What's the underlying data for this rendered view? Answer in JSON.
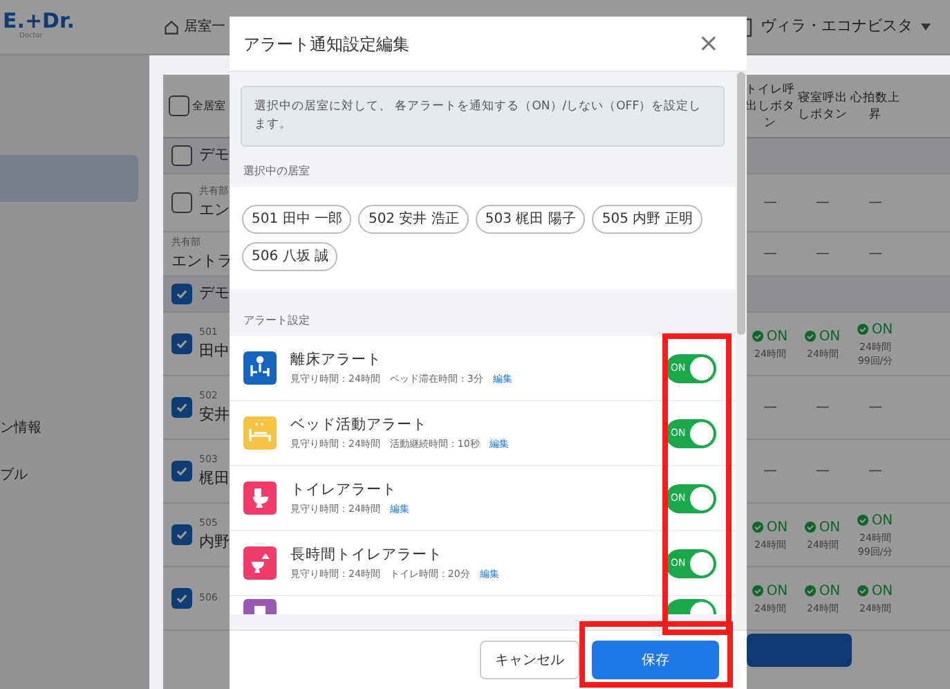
{
  "app": {
    "logo": "E.+Dr.",
    "logo_sub": "Doctor",
    "nav_label": "居室一",
    "facility": "ヴィラ・エコナビスタ"
  },
  "sidebar": {
    "items": [
      {
        "selected": true
      },
      {
        "label": "ン情報",
        "selected": false
      },
      {
        "label": "ブル",
        "selected": false
      }
    ]
  },
  "table": {
    "select_all": {
      "label": "全居室",
      "checked": false
    },
    "columns": [
      "トイレ呼出しボタン",
      "寝室呼出しボタン",
      "心拍数上昇"
    ],
    "rows": [
      {
        "kind": "group",
        "label": "デモ",
        "checked": false
      },
      {
        "kind": "room",
        "sub": "共有部",
        "label": "エン",
        "checked": false,
        "cells": [
          {
            "kind": "none",
            "text": "—"
          },
          {
            "kind": "none",
            "text": "—"
          },
          {
            "kind": "none",
            "text": "—"
          }
        ]
      },
      {
        "kind": "room",
        "sub": "共有部",
        "label": "エントラ",
        "cells": [
          {
            "kind": "none",
            "text": "—"
          },
          {
            "kind": "none",
            "text": "—"
          },
          {
            "kind": "none",
            "text": "—"
          }
        ]
      },
      {
        "kind": "group",
        "label": "デモ",
        "checked": true
      },
      {
        "kind": "room",
        "sub": "501",
        "label": "田中",
        "checked": true,
        "cells": [
          {
            "kind": "on",
            "text": "ON",
            "hours": "24時間"
          },
          {
            "kind": "on",
            "text": "ON",
            "hours": "24時間"
          },
          {
            "kind": "on",
            "text": "ON",
            "hours": "24時間",
            "extra": "99回/分"
          }
        ]
      },
      {
        "kind": "room",
        "sub": "502",
        "label": "安井",
        "checked": true,
        "cells": [
          {
            "kind": "none",
            "text": "—"
          },
          {
            "kind": "none",
            "text": "—"
          },
          {
            "kind": "none",
            "text": "—"
          }
        ]
      },
      {
        "kind": "room",
        "sub": "503",
        "label": "梶田",
        "checked": true,
        "cells": [
          {
            "kind": "none",
            "text": "—"
          },
          {
            "kind": "none",
            "text": "—"
          },
          {
            "kind": "none",
            "text": "—"
          }
        ]
      },
      {
        "kind": "room",
        "sub": "505",
        "label": "内野",
        "checked": true,
        "cells": [
          {
            "kind": "on",
            "text": "ON",
            "hours": "24時間"
          },
          {
            "kind": "on",
            "text": "ON",
            "hours": "24時間"
          },
          {
            "kind": "on",
            "text": "ON",
            "hours": "24時間",
            "extra": "99回/分"
          }
        ]
      },
      {
        "kind": "room",
        "sub": "506",
        "checked": true,
        "cells": [
          {
            "kind": "on",
            "text": "ON",
            "hours": "24時間"
          },
          {
            "kind": "on",
            "text": "ON",
            "hours": "24時間"
          },
          {
            "kind": "on",
            "text": "ON",
            "hours": "24時間"
          }
        ]
      }
    ]
  },
  "dialog": {
    "title": "アラート通知設定編集",
    "close": "×",
    "info": "選択中の居室に対して、 各アラートを通知する（ON）/しない（OFF）を設定します。",
    "rooms_label": "選択中の居室",
    "rooms": [
      "501 田中 一郎",
      "502 安井 浩正",
      "503 梶田 陽子",
      "505 内野 正明",
      "506 八坂 誠"
    ],
    "alerts_label": "アラート設定",
    "alerts": [
      {
        "kind": "bed-exit",
        "color": "#1565c0",
        "title": "離床アラート",
        "details": [
          "見守り時間：24時間",
          "ベッド滞在時間：3分"
        ],
        "edit": "編集",
        "on": true,
        "switch_label": "ON"
      },
      {
        "kind": "bed-activity",
        "color": "#f5c342",
        "title": "ベッド活動アラート",
        "details": [
          "見守り時間：24時間",
          "活動継続時間：10秒"
        ],
        "edit": "編集",
        "on": true,
        "switch_label": "ON"
      },
      {
        "kind": "toilet",
        "color": "#f23c6a",
        "title": "トイレアラート",
        "details": [
          "見守り時間：24時間"
        ],
        "edit": "編集",
        "on": true,
        "switch_label": "ON"
      },
      {
        "kind": "long-toilet",
        "color": "#f23c6a",
        "title": "長時間トイレアラート",
        "details": [
          "見守り時間：24時間",
          "トイレ時間：20分"
        ],
        "edit": "編集",
        "on": true,
        "switch_label": "ON"
      },
      {
        "kind": "door",
        "color": "#9b59b6",
        "on": true
      }
    ],
    "cancel": "キャンセル",
    "save": "保存"
  },
  "highlights": {
    "toggles": true,
    "save_button": true
  }
}
